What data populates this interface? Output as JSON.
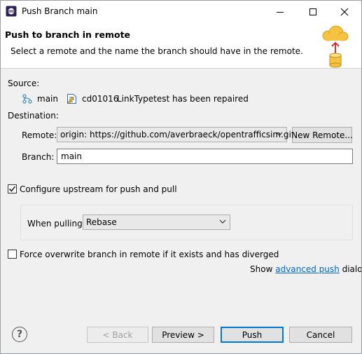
{
  "window": {
    "title": "Push Branch main",
    "icon": "eclipse-icon"
  },
  "banner": {
    "title": "Push to branch in remote",
    "description": "Select a remote and the name the branch should have in the remote.",
    "icon": "cloud-push-icon"
  },
  "source": {
    "label": "Source:",
    "branch": "main",
    "commit": "cd01016",
    "message": "LinkTypetest has been repaired"
  },
  "destination": {
    "label": "Destination:",
    "remote_label": "Remote:",
    "remote_value": "origin: https://github.com/averbraeck/opentrafficsim.git",
    "new_remote_label": "New Remote...",
    "branch_label": "Branch:",
    "branch_value": "main"
  },
  "upstream": {
    "label": "Configure upstream for push and pull",
    "checked": true,
    "when_pulling_label": "When pulling:",
    "when_pulling_value": "Rebase"
  },
  "force": {
    "label": "Force overwrite branch in remote if it exists and has diverged",
    "checked": false
  },
  "advanced": {
    "prefix": "Show",
    "link": "advanced push",
    "suffix": "dialog"
  },
  "buttons": {
    "back": "< Back",
    "preview": "Preview >",
    "push": "Push",
    "cancel": "Cancel"
  },
  "colors": {
    "link": "#0066cc",
    "accent": "#0078d7"
  }
}
